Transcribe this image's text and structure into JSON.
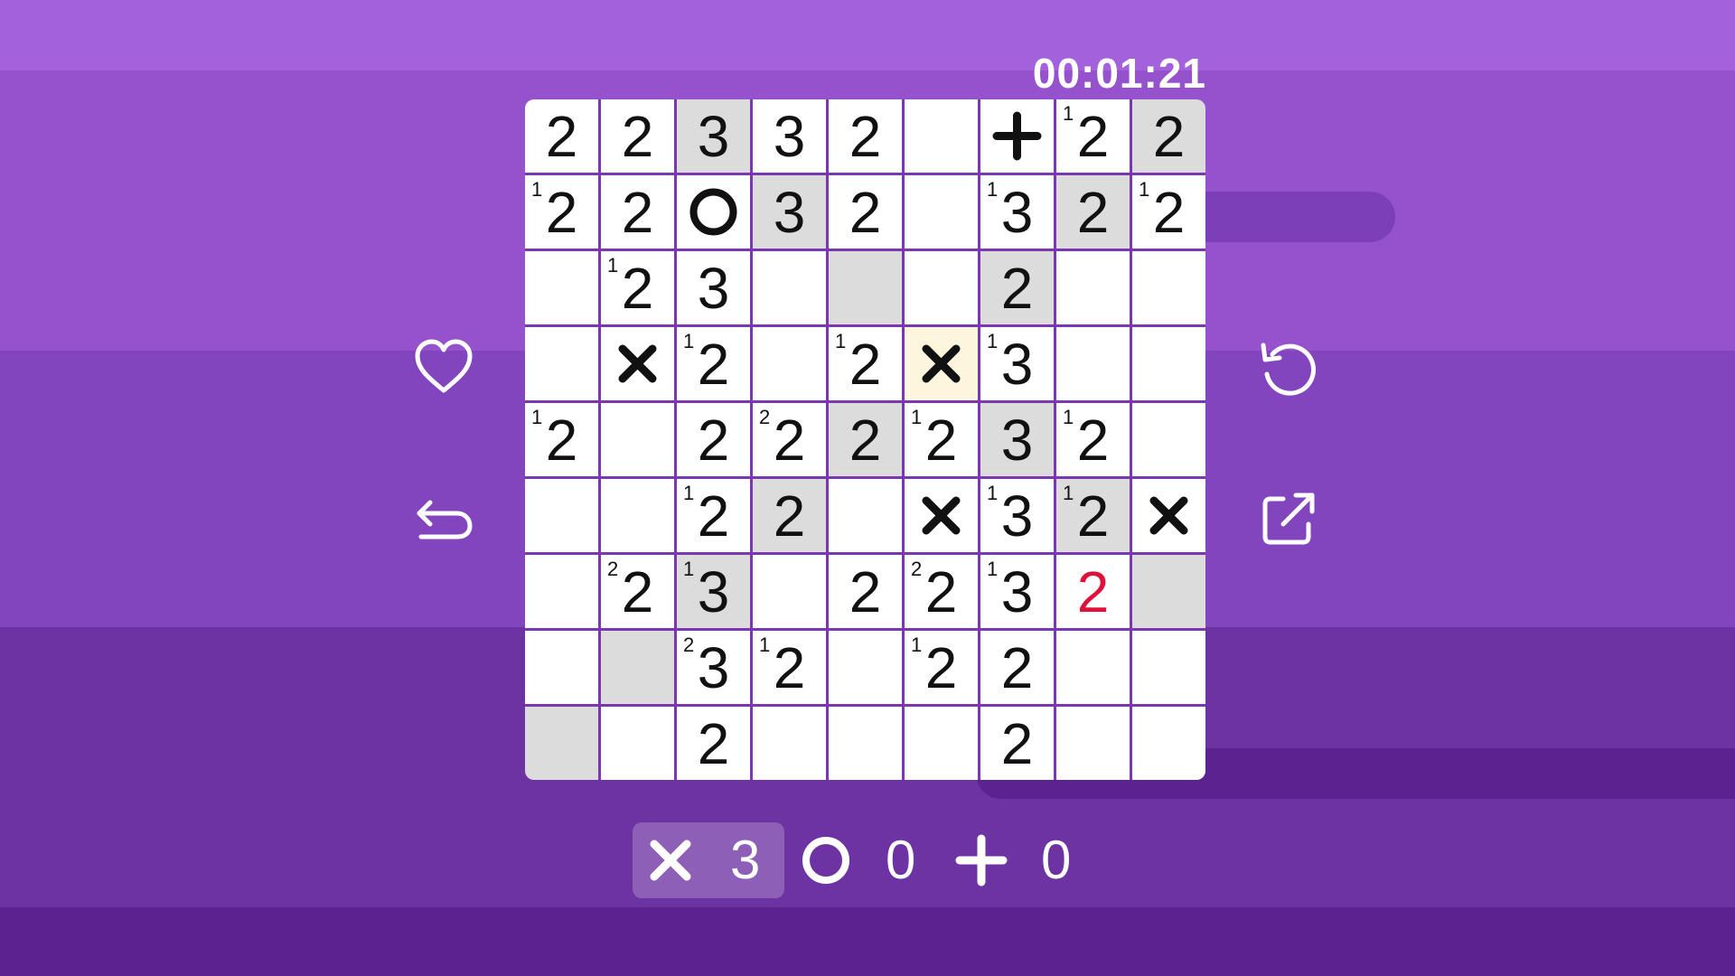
{
  "timer": "00:01:21",
  "colors": {
    "accent": "#9552cc",
    "shaded": "#dcdcdc",
    "highlight": "#fdf6dc",
    "error": "#e0103a"
  },
  "buttons": {
    "favorite": "heart-icon",
    "undo": "undo-icon",
    "restart": "restart-icon",
    "share": "share-icon"
  },
  "board": {
    "size": 9,
    "cells": [
      [
        {
          "v": "2"
        },
        {
          "v": "2"
        },
        {
          "v": "3",
          "shaded": true
        },
        {
          "v": "3"
        },
        {
          "v": "2"
        },
        {},
        {
          "mark": "plus"
        },
        {
          "v": "2",
          "sup": "1"
        },
        {
          "v": "2",
          "shaded": true
        }
      ],
      [
        {
          "v": "2",
          "sup": "1"
        },
        {
          "v": "2"
        },
        {
          "mark": "circle"
        },
        {
          "v": "3",
          "shaded": true
        },
        {
          "v": "2"
        },
        {},
        {
          "v": "3",
          "sup": "1"
        },
        {
          "v": "2",
          "shaded": true
        },
        {
          "v": "2",
          "sup": "1"
        }
      ],
      [
        {},
        {
          "v": "2",
          "sup": "1"
        },
        {
          "v": "3"
        },
        {},
        {
          "shaded": true
        },
        {},
        {
          "v": "2",
          "shaded": true
        },
        {},
        {}
      ],
      [
        {},
        {
          "mark": "cross"
        },
        {
          "v": "2",
          "sup": "1"
        },
        {},
        {
          "v": "2",
          "sup": "1"
        },
        {
          "mark": "cross",
          "yellow": true
        },
        {
          "v": "3",
          "sup": "1"
        },
        {},
        {}
      ],
      [
        {
          "v": "2",
          "sup": "1"
        },
        {},
        {
          "v": "2"
        },
        {
          "v": "2",
          "sup": "2"
        },
        {
          "v": "2",
          "shaded": true
        },
        {
          "v": "2",
          "sup": "1"
        },
        {
          "v": "3",
          "shaded": true
        },
        {
          "v": "2",
          "sup": "1"
        },
        {}
      ],
      [
        {},
        {},
        {
          "v": "2",
          "sup": "1"
        },
        {
          "v": "2",
          "shaded": true
        },
        {},
        {
          "mark": "cross"
        },
        {
          "v": "3",
          "sup": "1"
        },
        {
          "v": "2",
          "sup": "1",
          "shaded": true
        },
        {
          "mark": "cross"
        }
      ],
      [
        {},
        {
          "v": "2",
          "sup": "2"
        },
        {
          "v": "3",
          "sup": "1",
          "shaded": true
        },
        {},
        {
          "v": "2"
        },
        {
          "v": "2",
          "sup": "2"
        },
        {
          "v": "3",
          "sup": "1"
        },
        {
          "v": "2",
          "red": true
        },
        {
          "shaded": true
        }
      ],
      [
        {},
        {
          "shaded": true
        },
        {
          "v": "3",
          "sup": "2"
        },
        {
          "v": "2",
          "sup": "1"
        },
        {},
        {
          "v": "2",
          "sup": "1"
        },
        {
          "v": "2"
        },
        {},
        {}
      ],
      [
        {
          "shaded": true
        },
        {},
        {
          "v": "2"
        },
        {},
        {},
        {},
        {
          "v": "2"
        },
        {},
        {}
      ]
    ]
  },
  "counters": {
    "cross": {
      "icon": "cross-icon",
      "count": "3",
      "selected": true
    },
    "circle": {
      "icon": "circle-icon",
      "count": "0"
    },
    "plus": {
      "icon": "plus-icon",
      "count": "0"
    }
  }
}
